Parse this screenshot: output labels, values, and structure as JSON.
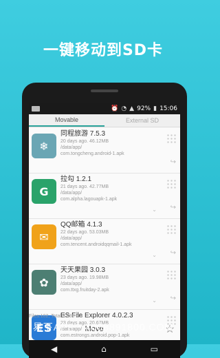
{
  "headline": "一键移动到SD卡",
  "status": {
    "battery": "92%",
    "time": "15:06"
  },
  "tabs": [
    {
      "label": "Movable"
    },
    {
      "label": "External SD"
    }
  ],
  "apps": [
    {
      "title": "同程旅游 7.5.3",
      "meta": "20 days ago. 46.12MB",
      "path": "/data/app/",
      "pkg": "com.tongcheng.android-1.apk",
      "icon": "tongcheng-icon",
      "color": "#6aa6b4"
    },
    {
      "title": "拉勾 1.2.1",
      "meta": "21 days ago. 42.77MB",
      "path": "/data/app/",
      "pkg": "com.alpha.lagouapk-1.apk",
      "icon": "lagou-icon",
      "color": "#2aa36a"
    },
    {
      "title": "QQ邮箱 4.1.3",
      "meta": "22 days ago. 53.03MB",
      "path": "/data/app/",
      "pkg": "com.tencent.androidqqmail-1.apk",
      "icon": "qqmail-icon",
      "color": "#f0a21a"
    },
    {
      "title": "天天果园 3.0.3",
      "meta": "23 days ago. 19.98MB",
      "path": "/data/app/",
      "pkg": "com.ttxg.fruitday-2.apk",
      "icon": "fruitday-icon",
      "color": "#4d7f73"
    },
    {
      "title": "ES File Explorer 4.0.2.3",
      "meta": "23 days ago. 20.67MB",
      "path": "/data/app/",
      "pkg": "com.estrongs.android.pop-1.apk",
      "icon": "es-file-explorer-icon",
      "color": "#2a7bd6"
    }
  ],
  "footer": {
    "files_text": "Files:102, Total:3.886 GB",
    "move_label": "Move"
  },
  "watermark": "易下APP・4008891800.COM"
}
